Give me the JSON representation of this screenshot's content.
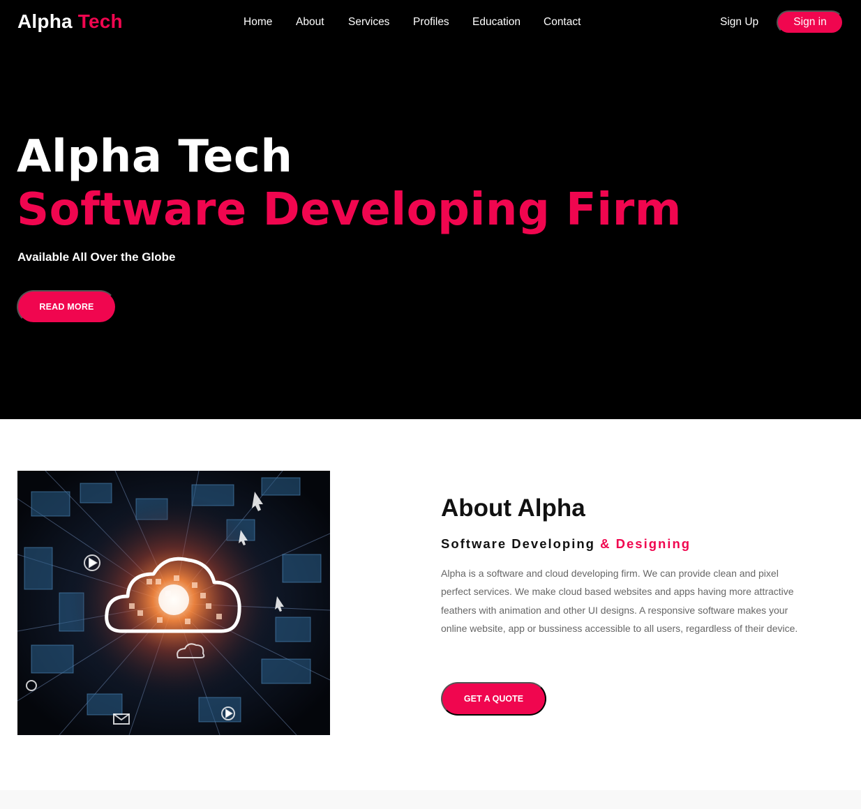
{
  "brand": {
    "name_part1": "Alpha",
    "name_part2": "Tech",
    "accent_color": "#f0064f"
  },
  "nav": {
    "items": [
      "Home",
      "About",
      "Services",
      "Profiles",
      "Education",
      "Contact"
    ],
    "signup_label": "Sign Up",
    "signin_label": "Sign in"
  },
  "hero": {
    "title": "Alpha Tech",
    "subtitle": "Software Developing Firm",
    "tagline": "Available All Over the Globe",
    "cta_label": "READ MORE",
    "background": "#000000"
  },
  "about": {
    "heading": "About Alpha",
    "subheading_part1": "Software Developing",
    "subheading_part2": "& Designing",
    "body": "Alpha is a software and cloud developing firm. We can provide clean and pixel perfect services. We make cloud based websites and apps having more attractive feathers with animation and other UI designs. A responsive software makes your online website, app or bussiness accessible to all users, regardless of their device.",
    "cta_label": "GET A QUOTE",
    "image_icon": "cloud-network-icon"
  }
}
